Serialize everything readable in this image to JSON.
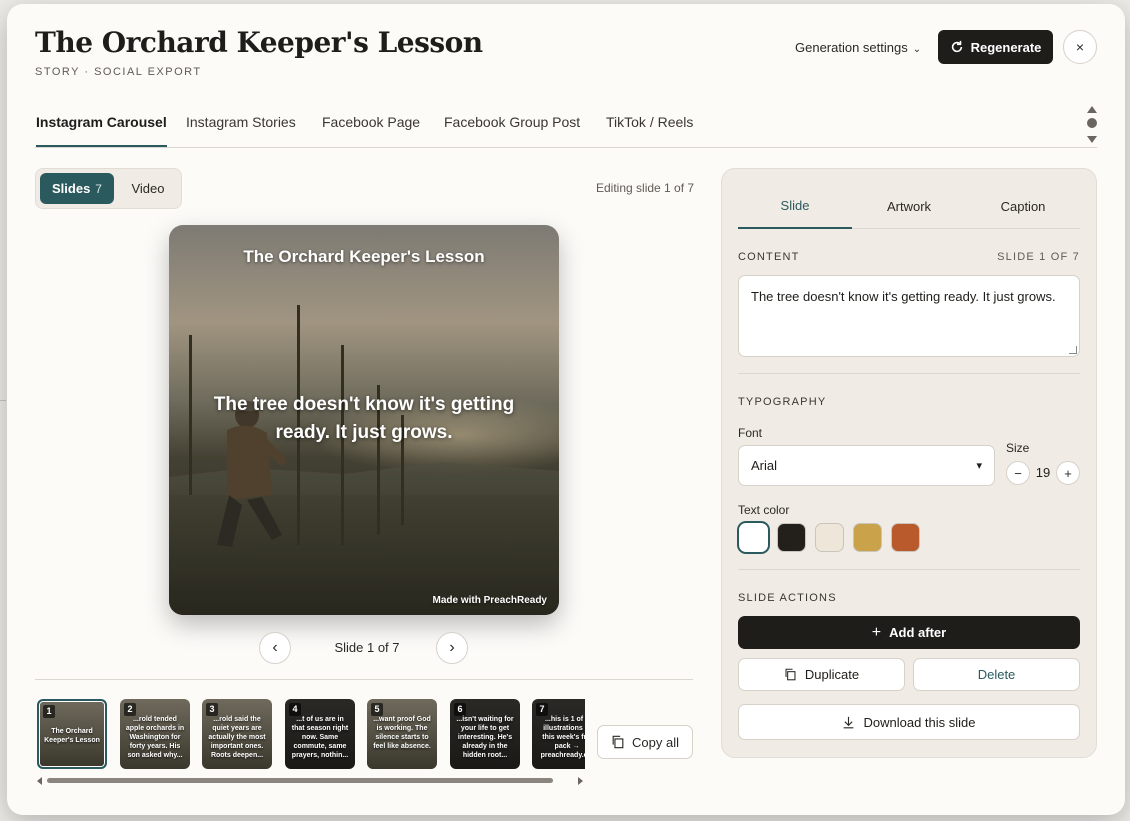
{
  "header": {
    "title": "The Orchard Keeper's Lesson",
    "subtitle": "Story · Social Export",
    "generation_settings": "Generation settings",
    "regenerate": "Regenerate",
    "close": "×"
  },
  "tabs": [
    {
      "label": "Instagram Carousel",
      "active": true
    },
    {
      "label": "Instagram Stories"
    },
    {
      "label": "Facebook Page"
    },
    {
      "label": "Facebook Group Post"
    },
    {
      "label": "TikTok / Reels"
    }
  ],
  "mode_toggle": {
    "slides_label": "Slides",
    "slides_count": "7",
    "video_label": "Video"
  },
  "editing_status": "Editing slide 1 of 7",
  "preview": {
    "title": "The Orchard Keeper's Lesson",
    "body": "The tree doesn't know it's getting ready. It just grows.",
    "watermark": "Made with PreachReady"
  },
  "pager": {
    "prev": "‹",
    "label": "Slide 1 of 7",
    "next": "›"
  },
  "thumbnails": [
    {
      "num": "1",
      "text": "The Orchard Keeper's Lesson"
    },
    {
      "num": "2",
      "text": "...rold tended apple orchards in Washington for forty years. His son asked why..."
    },
    {
      "num": "3",
      "text": "...rold said the quiet years are actually the most important ones. Roots deepen..."
    },
    {
      "num": "4",
      "text": "...t of us are in that season right now. Same commute, same prayers, nothin..."
    },
    {
      "num": "5",
      "text": "...want proof God is working. The silence starts to feel like absence."
    },
    {
      "num": "6",
      "text": "...isn't waiting for your life to get interesting. He's already in the hidden root..."
    },
    {
      "num": "7",
      "text": "...his is 1 of 6 illustrations in this week's fr... pack → preachready.c..."
    }
  ],
  "copy_all": "Copy all",
  "panel": {
    "tabs": [
      "Slide",
      "Artwork",
      "Caption"
    ],
    "content_label": "Content",
    "slide_of": "Slide 1 of 7",
    "content_text": "The tree doesn't know it's getting ready. It just grows.",
    "typography_label": "Typography",
    "font_label": "Font",
    "font_value": "Arial",
    "size_label": "Size",
    "size_value": "19",
    "text_color_label": "Text color",
    "swatches": [
      "#ffffff",
      "#231f1a",
      "#ede6d9",
      "#c9a24a",
      "#b85a2c"
    ],
    "actions_label": "Slide Actions",
    "add_after": "Add after",
    "duplicate": "Duplicate",
    "delete": "Delete",
    "download": "Download this slide"
  },
  "colors": {
    "accent": "#2b5a5e",
    "dark": "#1f1d1a",
    "panel": "#f0ece5"
  }
}
